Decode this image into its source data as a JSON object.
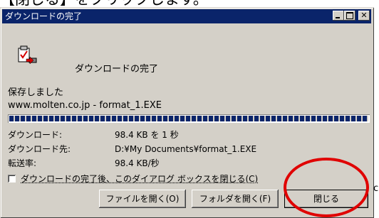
{
  "caption": "【閉じる】をクリックします。",
  "window": {
    "title": "ダウンロードの完了",
    "controls": [
      "minimize",
      "maximize",
      "close"
    ]
  },
  "dialog": {
    "icon": "download-complete-icon",
    "heading": "ダウンロードの完了",
    "saved_label": "保存しました",
    "file_url": "www.molten.co.jp - format_1.EXE",
    "progress_percent": 100,
    "info": [
      {
        "label": "ダウンロード:",
        "value": "98.4 KB を 1 秒"
      },
      {
        "label": "ダウンロード先:",
        "value": "D:¥My Documents¥format_1.EXE"
      },
      {
        "label": "転送率:",
        "value": "98.4 KB/秒"
      }
    ],
    "close_on_complete": {
      "checked": false,
      "label": "ダウンロードの完了後、このダイアログ ボックスを閉じる(C)"
    },
    "buttons": {
      "open_file": "ファイルを開く(O)",
      "open_folder": "フォルダを開く(F)",
      "close": "閉じる"
    }
  },
  "side_mark": "c",
  "colors": {
    "titlebar": "#0a246a",
    "face": "#d4d0c8",
    "highlight": "#e00000"
  }
}
